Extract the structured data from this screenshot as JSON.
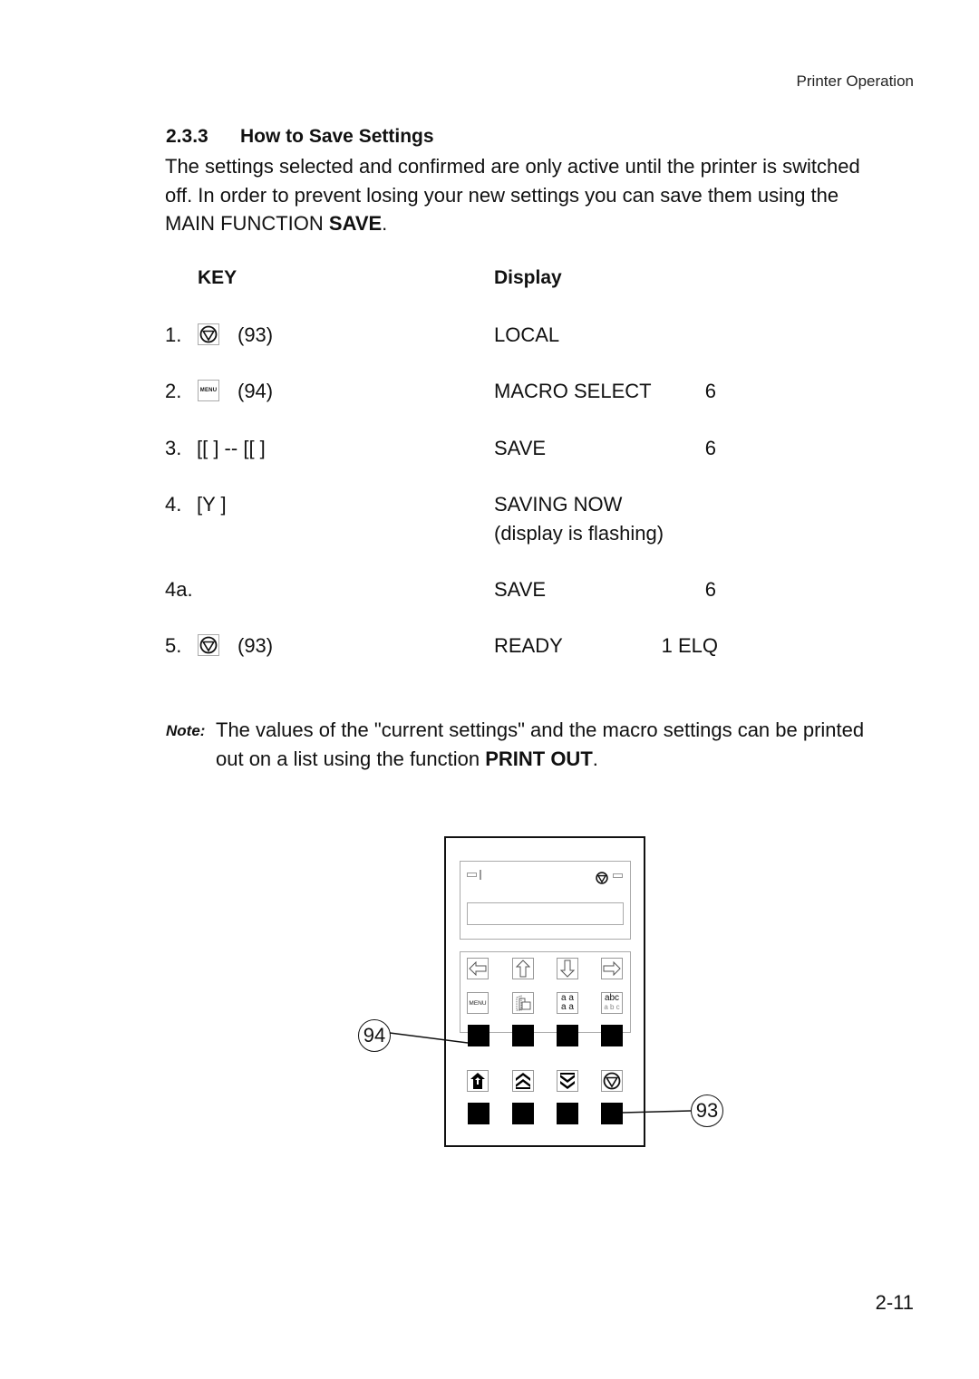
{
  "running_head": "Printer Operation",
  "section": {
    "number": "2.3.3",
    "title": "How to Save Settings"
  },
  "intro": {
    "line1": "The settings selected and confirmed are only active until the printer is switched",
    "line2": "off. In order to prevent losing your new settings you can save them using the",
    "line3_prefix": "MAIN FUNCTION ",
    "line3_bold": "SAVE",
    "line3_suffix": "."
  },
  "table": {
    "key_header": "KEY",
    "display_header": "Display",
    "steps": [
      {
        "num": "1.",
        "key_icon": "stop-online-icon",
        "key_text": "(93)",
        "display": "LOCAL",
        "value": ""
      },
      {
        "num": "2.",
        "key_icon": "menu-key-icon",
        "key_icon_label": "MENU",
        "key_text": "(94)",
        "display": "MACRO SELECT",
        "value": "6"
      },
      {
        "num": "3.",
        "key_icon": "",
        "key_text": "[[ ] -- [[ ]",
        "display": "SAVE",
        "value": "6"
      },
      {
        "num": "4.",
        "key_icon": "",
        "key_text": "[Y ]",
        "display": "SAVING NOW",
        "display_sub": "(display is flashing)",
        "value": ""
      },
      {
        "num": "4a.",
        "key_icon": "",
        "key_text": "",
        "display": "SAVE",
        "value": "6"
      },
      {
        "num": "5.",
        "key_icon": "stop-online-icon",
        "key_text": "(93)",
        "display": "READY",
        "value": "1 ELQ"
      }
    ]
  },
  "note": {
    "label": "Note:",
    "line1": "The values of the \"current settings\" and the macro settings can be printed",
    "line2_prefix": "out on a list using the function ",
    "line2_bold": "PRINT OUT",
    "line2_suffix": "."
  },
  "figure": {
    "menu_label": "MENU",
    "font_key_top": "a a",
    "font_key_bottom": "a a",
    "pitch_key_top": "abc",
    "pitch_key_bottom": "a b c",
    "callout_94": "94",
    "callout_93": "93"
  },
  "page_number": "2-11"
}
